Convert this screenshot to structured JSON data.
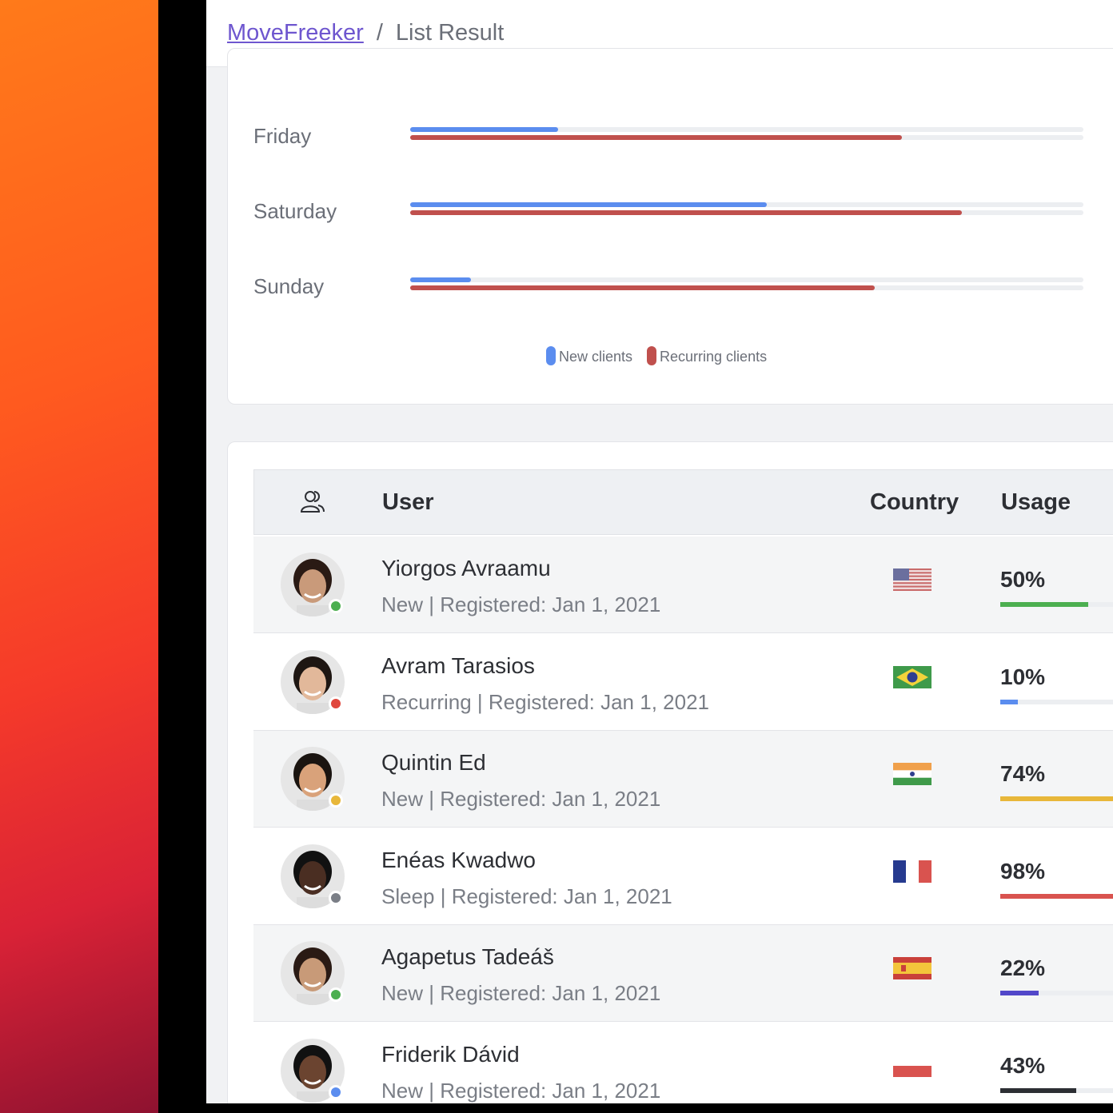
{
  "breadcrumb": {
    "link": "MoveFreeker",
    "separator": "/",
    "current": "List Result"
  },
  "chart_data": {
    "type": "bar",
    "orientation": "horizontal",
    "categories": [
      "Friday",
      "Saturday",
      "Sunday"
    ],
    "series": [
      {
        "name": "New clients",
        "color": "#5b8def",
        "values": [
          22,
          53,
          9
        ]
      },
      {
        "name": "Recurring clients",
        "color": "#c0504d",
        "values": [
          73,
          82,
          69
        ]
      }
    ],
    "ylim": [
      0,
      100
    ],
    "legend": "bottom-center"
  },
  "table": {
    "headers": {
      "user": "User",
      "country": "Country",
      "usage": "Usage"
    },
    "rows": [
      {
        "name": "Yiorgos Avraamu",
        "sub": "New | Registered: Jan 1, 2021",
        "flag": "us",
        "usage_label": "50%",
        "usage": 50,
        "bar_color": "#4caf50",
        "status_color": "#4caf50"
      },
      {
        "name": "Avram Tarasios",
        "sub": "Recurring | Registered: Jan 1, 2021",
        "flag": "br",
        "usage_label": "10%",
        "usage": 10,
        "bar_color": "#5b8def",
        "status_color": "#e0473d"
      },
      {
        "name": "Quintin Ed",
        "sub": "New | Registered: Jan 1, 2021",
        "flag": "in",
        "usage_label": "74%",
        "usage": 74,
        "bar_color": "#e8b73a",
        "status_color": "#e8b73a"
      },
      {
        "name": "Enéas Kwadwo",
        "sub": "Sleep | Registered: Jan 1, 2021",
        "flag": "fr",
        "usage_label": "98%",
        "usage": 98,
        "bar_color": "#d9534f",
        "status_color": "#7a7e86"
      },
      {
        "name": "Agapetus Tadeáš",
        "sub": "New | Registered: Jan 1, 2021",
        "flag": "es",
        "usage_label": "22%",
        "usage": 22,
        "bar_color": "#5247c9",
        "status_color": "#4caf50"
      },
      {
        "name": "Friderik Dávid",
        "sub": "New | Registered: Jan 1, 2021",
        "flag": "pl",
        "usage_label": "43%",
        "usage": 43,
        "bar_color": "#2d2f34",
        "status_color": "#5b8def"
      }
    ]
  }
}
